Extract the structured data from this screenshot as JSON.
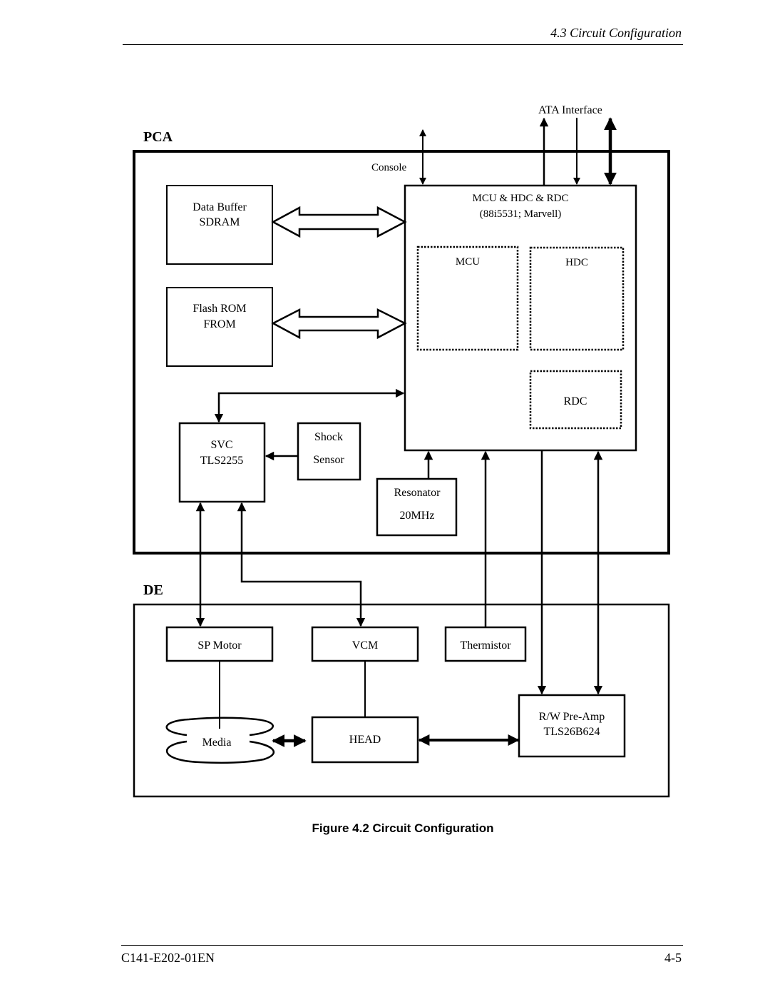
{
  "header": {
    "section_title": "4.3  Circuit Configuration"
  },
  "diagram": {
    "pca_label": "PCA",
    "de_label": "DE",
    "ata_interface_label": "ATA Interface",
    "console_label": "Console",
    "blocks": {
      "mcu_hdc_rdc": {
        "line1": "MCU & HDC & RDC",
        "line2": "(88i5531; Marvell)"
      },
      "mcu": {
        "label": "MCU"
      },
      "hdc": {
        "label": "HDC"
      },
      "rdc": {
        "label": "RDC"
      },
      "data_buffer": {
        "line1": "Data Buffer",
        "line2": "SDRAM"
      },
      "flash_rom": {
        "line1": "Flash ROM",
        "line2": "FROM"
      },
      "svc": {
        "line1": "SVC",
        "line2": "TLS2255"
      },
      "shock_sensor": {
        "line1": "Shock",
        "line2": "Sensor"
      },
      "resonator": {
        "line1": "Resonator",
        "line2": "20MHz"
      },
      "sp_motor": {
        "label": "SP Motor"
      },
      "vcm": {
        "label": "VCM"
      },
      "thermistor": {
        "label": "Thermistor"
      },
      "media": {
        "label": "Media"
      },
      "head": {
        "label": "HEAD"
      },
      "rw_preamp": {
        "line1": "R/W Pre-Amp",
        "line2": "TLS26B624"
      }
    }
  },
  "caption": "Figure 4.2  Circuit Configuration",
  "footer": {
    "doc_id": "C141-E202-01EN",
    "page_number": "4-5"
  }
}
